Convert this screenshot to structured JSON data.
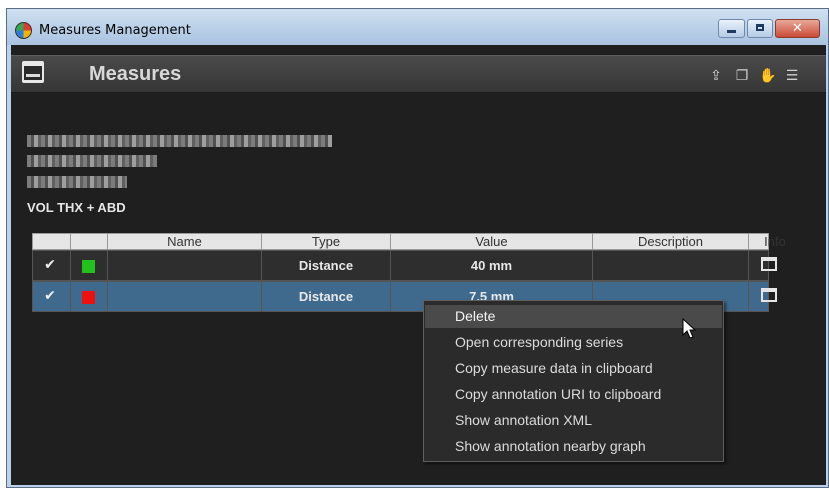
{
  "window": {
    "title": "Measures Management",
    "buttons": {
      "minimize_icon": "minimize-icon",
      "maximize_icon": "maximize-icon",
      "close_icon": "close-icon",
      "close_glyph": "✕"
    }
  },
  "header": {
    "title": "Measures",
    "tools": [
      {
        "icon": "export-icon",
        "glyph": "⇪"
      },
      {
        "icon": "copy-icon",
        "glyph": "❐"
      },
      {
        "icon": "hand-icon",
        "glyph": "✋"
      },
      {
        "icon": "database-icon",
        "glyph": "☰"
      }
    ]
  },
  "series": {
    "label": "VOL THX + ABD"
  },
  "table": {
    "columns": [
      "",
      "",
      "Name",
      "Type",
      "Value",
      "Description",
      "Info"
    ],
    "rows": [
      {
        "checked": "✔",
        "color": "#22c11b",
        "name": "",
        "type": "Distance",
        "value": "40 mm",
        "description": ""
      },
      {
        "checked": "✔",
        "color": "#ee1111",
        "name": "",
        "type": "Distance",
        "value": "7.5 mm",
        "description": ""
      }
    ]
  },
  "context_menu": {
    "items": [
      "Delete",
      "Open corresponding series",
      "Copy measure data in clipboard",
      "Copy annotation URI to clipboard",
      "Show annotation XML",
      "Show annotation nearby graph"
    ]
  },
  "colors": {
    "selected_row": "#3f6a8e",
    "panel_bg": "#1f1f1f"
  }
}
